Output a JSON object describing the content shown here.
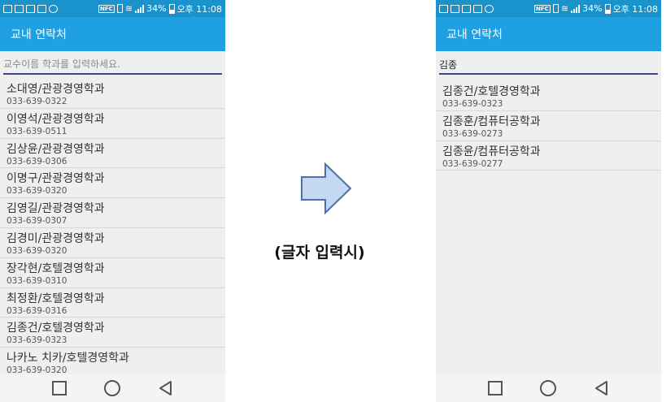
{
  "status_bar": {
    "battery": "34%",
    "time": "오후 11:08",
    "nfc": "NFC"
  },
  "left_phone": {
    "title": "교내 연락처",
    "search_placeholder": "교수이름 학과를 입력하세요.",
    "search_value": "",
    "items": [
      {
        "name": "소대영/관광경영학과",
        "phone": "033-639-0322"
      },
      {
        "name": "이영석/관광경영학과",
        "phone": "033-639-0511"
      },
      {
        "name": "김상윤/관광경영학과",
        "phone": "033-639-0306"
      },
      {
        "name": "이명구/관광경영학과",
        "phone": "033-639-0320"
      },
      {
        "name": "김영길/관광경영학과",
        "phone": "033-639-0307"
      },
      {
        "name": "김경미/관광경영학과",
        "phone": "033-639-0320"
      },
      {
        "name": "장각현/호텔경영학과",
        "phone": "033-639-0310"
      },
      {
        "name": "최정환/호텔경영학과",
        "phone": "033-639-0316"
      },
      {
        "name": "김종건/호텔경영학과",
        "phone": "033-639-0323"
      },
      {
        "name": "나카노 치카/호텔경영학과",
        "phone": "033-639-0320"
      }
    ]
  },
  "right_phone": {
    "title": "교내 연락처",
    "search_value": "김종",
    "items": [
      {
        "name": "김종건/호텔경영학과",
        "phone": "033-639-0323"
      },
      {
        "name": "김종훈/컴퓨터공학과",
        "phone": "033-639-0273"
      },
      {
        "name": "김종윤/컴퓨터공학과",
        "phone": "033-639-0277"
      }
    ]
  },
  "caption": "(글자 입력시)",
  "icons": {
    "arrow": "right-arrow-icon",
    "nav_back": "back-triangle-icon",
    "nav_home": "home-circle-icon",
    "nav_recent": "recent-square-icon"
  },
  "colors": {
    "app_bar": "#1ea0e3",
    "status_bar": "#1a93cd",
    "search_underline": "#3b4a8f",
    "arrow_fill": "#c5d8f1",
    "arrow_stroke": "#4f6fa8"
  }
}
